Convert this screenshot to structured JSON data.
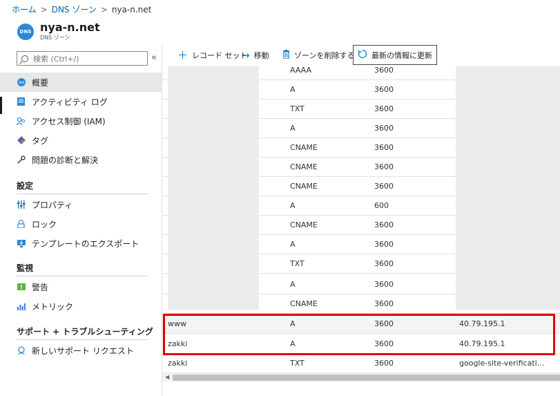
{
  "breadcrumb": {
    "home": "ホーム",
    "dns_zones": "DNS ゾーン",
    "current": "nya-n.net",
    "sep": ">"
  },
  "resource": {
    "badge": "DNS",
    "title": "nya-n.net",
    "subtitle": "DNS ゾーン"
  },
  "sidebar": {
    "search_placeholder": "検索 (Ctrl+/)",
    "collapse": "«",
    "items": [
      {
        "label": "概要",
        "icon": "dns-overview-icon"
      },
      {
        "label": "アクティビティ ログ",
        "icon": "activity-log-icon"
      },
      {
        "label": "アクセス制御 (IAM)",
        "icon": "people-icon"
      },
      {
        "label": "タグ",
        "icon": "tag-icon"
      },
      {
        "label": "問題の診断と解決",
        "icon": "wrench-icon"
      }
    ],
    "sections": [
      {
        "title": "設定",
        "items": [
          {
            "label": "プロパティ",
            "icon": "properties-icon"
          },
          {
            "label": "ロック",
            "icon": "lock-icon"
          },
          {
            "label": "テンプレートのエクスポート",
            "icon": "export-template-icon"
          }
        ]
      },
      {
        "title": "監視",
        "items": [
          {
            "label": "警告",
            "icon": "alert-icon"
          },
          {
            "label": "メトリック",
            "icon": "metrics-icon"
          }
        ]
      },
      {
        "title": "サポート + トラブルシューティング",
        "items": [
          {
            "label": "新しいサポート リクエスト",
            "icon": "support-icon"
          }
        ]
      }
    ]
  },
  "toolbar": {
    "add_record_set": "レコード セット",
    "move": "移動",
    "delete_zone": "ゾーンを削除する",
    "refresh": "最新の情報に更新"
  },
  "records": [
    {
      "name": "",
      "type": "AAAA",
      "ttl": "3600",
      "value": ""
    },
    {
      "name": "",
      "type": "A",
      "ttl": "3600",
      "value": ""
    },
    {
      "name": "",
      "type": "TXT",
      "ttl": "3600",
      "value": ""
    },
    {
      "name": "",
      "type": "A",
      "ttl": "3600",
      "value": ""
    },
    {
      "name": "",
      "type": "CNAME",
      "ttl": "3600",
      "value": ""
    },
    {
      "name": "",
      "type": "CNAME",
      "ttl": "3600",
      "value": ""
    },
    {
      "name": "",
      "type": "CNAME",
      "ttl": "3600",
      "value": ""
    },
    {
      "name": "",
      "type": "A",
      "ttl": "600",
      "value": ""
    },
    {
      "name": "",
      "type": "CNAME",
      "ttl": "3600",
      "value": ""
    },
    {
      "name": "",
      "type": "A",
      "ttl": "3600",
      "value": ""
    },
    {
      "name": "",
      "type": "TXT",
      "ttl": "3600",
      "value": ""
    },
    {
      "name": "",
      "type": "A",
      "ttl": "3600",
      "value": ""
    },
    {
      "name": "",
      "type": "CNAME",
      "ttl": "3600",
      "value": ""
    },
    {
      "name": "www",
      "type": "A",
      "ttl": "3600",
      "value": "40.79.195.1"
    },
    {
      "name": "zakki",
      "type": "A",
      "ttl": "3600",
      "value": "40.79.195.1"
    },
    {
      "name": "zakki",
      "type": "TXT",
      "ttl": "3600",
      "value": "google-site-verificati..."
    }
  ],
  "colors": {
    "accent": "#0078d4",
    "highlight_border": "#e00000",
    "redaction": "#ececec"
  }
}
